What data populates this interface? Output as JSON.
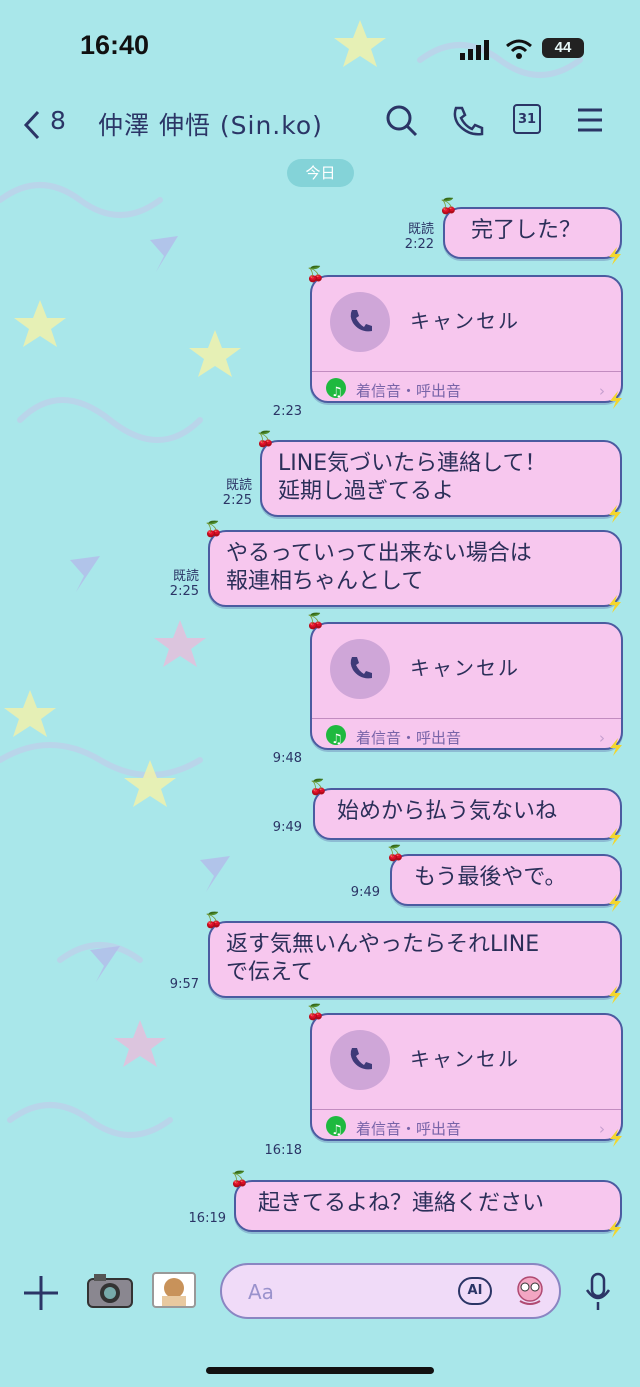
{
  "status_bar": {
    "time": "16:40",
    "battery": "44"
  },
  "header": {
    "back_count": "8",
    "contact_name": "仲澤 伸悟 (Sin.ko)",
    "calendar_day": "31"
  },
  "day_label": "今日",
  "messages": [
    {
      "type": "text",
      "read": "既読",
      "time": "2:22",
      "lines": [
        "完了した？"
      ]
    },
    {
      "type": "call",
      "read": "",
      "time": "2:23",
      "label": "キャンセル",
      "ringtone": "着信音・呼出音"
    },
    {
      "type": "text",
      "read": "既読",
      "time": "2:25",
      "lines": [
        "LINE気づいたら連絡して！",
        "延期し過ぎてるよ"
      ]
    },
    {
      "type": "text",
      "read": "既読",
      "time": "2:25",
      "lines": [
        "やるっていって出来ない場合は",
        "報連相ちゃんとして"
      ]
    },
    {
      "type": "call",
      "read": "",
      "time": "9:48",
      "label": "キャンセル",
      "ringtone": "着信音・呼出音"
    },
    {
      "type": "text",
      "read": "",
      "time": "9:49",
      "lines": [
        "始めから払う気ないね"
      ]
    },
    {
      "type": "text",
      "read": "",
      "time": "9:49",
      "lines": [
        "もう最後やで。"
      ]
    },
    {
      "type": "text",
      "read": "",
      "time": "9:57",
      "lines": [
        "返す気無いんやったらそれLINE",
        "で伝えて"
      ]
    },
    {
      "type": "call",
      "read": "",
      "time": "16:18",
      "label": "キャンセル",
      "ringtone": "着信音・呼出音"
    },
    {
      "type": "text",
      "read": "",
      "time": "16:19",
      "lines": [
        "起きてるよね？連絡ください"
      ]
    }
  ],
  "input": {
    "placeholder": "Aa",
    "ai_label": "AI"
  },
  "icons": [
    "back-chevron-icon",
    "search-icon",
    "phone-icon",
    "calendar-icon",
    "menu-icon",
    "plus-icon",
    "camera-icon",
    "photo-icon",
    "ai-icon",
    "sticker-icon",
    "mic-icon",
    "music-note-icon",
    "cherry-icon",
    "bolt-icon"
  ],
  "colors": {
    "background": "#a9e7ea",
    "bubble": "#f7c7ee",
    "bubble_border": "#4b5ba0",
    "text": "#2b2f59",
    "day_pill": "#84d3d8",
    "note_green": "#1eb93f"
  }
}
